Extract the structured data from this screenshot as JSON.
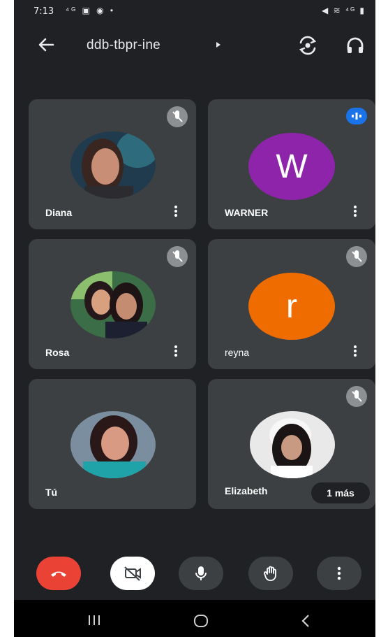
{
  "status_bar": {
    "time": "7:13",
    "left_icons": "⁴ᴳ ▣ ◉ •",
    "right_icons": "◀ ≋ ⁴ᴳ ▮"
  },
  "header": {
    "meeting_code": "ddb-tbpr-ine"
  },
  "participants": [
    {
      "name": "Diana",
      "state": "muted"
    },
    {
      "name": "WARNER",
      "avatar_letter": "W",
      "avatar_color": "#8e24aa",
      "state": "speaking"
    },
    {
      "name": "Rosa",
      "state": "muted"
    },
    {
      "name": "reyna",
      "avatar_letter": "r",
      "avatar_color": "#ef6c00",
      "state": "muted"
    },
    {
      "name": "Tú",
      "state": "self"
    },
    {
      "name": "Elizabeth",
      "state": "muted"
    }
  ],
  "overflow_label": "1 más",
  "colors": {
    "background": "#202124",
    "tile": "#3c4043",
    "end_call": "#ea4335",
    "speaking": "#1a73e8"
  },
  "controls": [
    "end-call",
    "camera-off",
    "microphone",
    "raise-hand",
    "more-options"
  ]
}
